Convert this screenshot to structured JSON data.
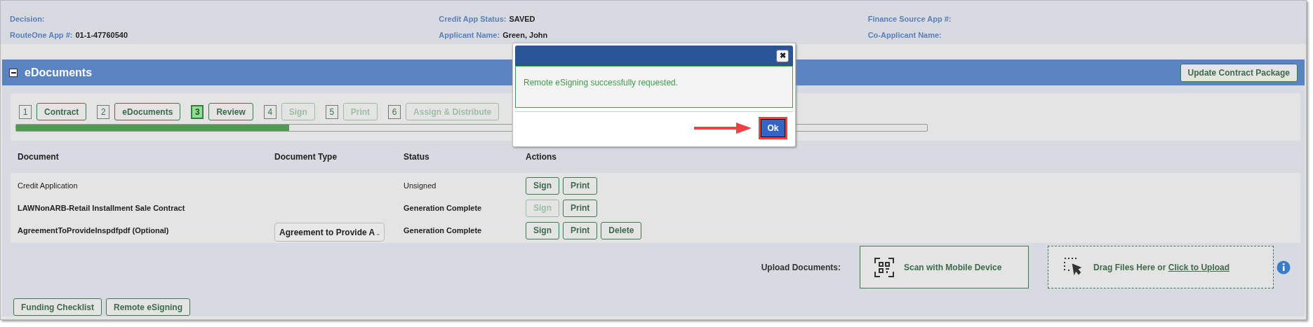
{
  "summary": {
    "fields": [
      {
        "label": "Decision:"
      },
      {
        "label": "Credit App Status:",
        "value": "SAVED"
      },
      {
        "label": "Finance Source App #:"
      },
      {
        "label": "RouteOne App #:",
        "value": "01-1-47760540"
      },
      {
        "label": "Applicant Name:",
        "value": "Green, John"
      },
      {
        "label": "Co-Applicant Name:"
      }
    ]
  },
  "section": {
    "title": "eDocuments",
    "expanded": true,
    "action_button": "Update Contract Package"
  },
  "steps": [
    {
      "number": "1",
      "label": "Contract",
      "selected": false,
      "disabled": false
    },
    {
      "number": "2",
      "label": "eDocuments",
      "selected": false,
      "disabled": false
    },
    {
      "number": "3",
      "label": "Review",
      "selected": true,
      "disabled": false
    },
    {
      "number": "4",
      "label": "Sign",
      "selected": false,
      "disabled": true
    },
    {
      "number": "5",
      "label": "Print",
      "selected": false,
      "disabled": true
    },
    {
      "number": "6",
      "label": "Assign & Distribute",
      "selected": false,
      "disabled": true
    }
  ],
  "progress": {
    "level": 0.3
  },
  "table": {
    "columns": [
      "Document",
      "Document Type",
      "Status",
      "Actions"
    ],
    "rows": [
      {
        "document": "Credit Application",
        "bold": false,
        "status": "Unsigned",
        "actions": [
          {
            "label": "Sign",
            "disabled": false
          },
          {
            "label": "Print",
            "disabled": false
          }
        ]
      },
      {
        "document": "LAWNonARB-Retail Installment Sale Contract",
        "bold": true,
        "status": "Generation Complete",
        "actions": [
          {
            "label": "Sign",
            "disabled": true
          },
          {
            "label": "Print",
            "disabled": false
          }
        ]
      },
      {
        "document": "AgreementToProvideInspdfpdf (Optional)",
        "bold": true,
        "document_type": "Agreement to Provide A",
        "status": "Generation Complete",
        "actions": [
          {
            "label": "Sign",
            "disabled": false
          },
          {
            "label": "Print",
            "disabled": false
          },
          {
            "label": "Delete",
            "disabled": false
          }
        ]
      }
    ]
  },
  "upload": {
    "label": "Upload Documents:",
    "scan_button": "Scan with Mobile Device",
    "drop_text": "Drag Files Here or ",
    "drop_link": "Click to Upload"
  },
  "footer_buttons": [
    "Funding Checklist",
    "Remote eSigning"
  ],
  "dialog": {
    "message": "Remote eSigning successfully requested.",
    "ok_button": "Ok",
    "close_icon": "✖"
  }
}
